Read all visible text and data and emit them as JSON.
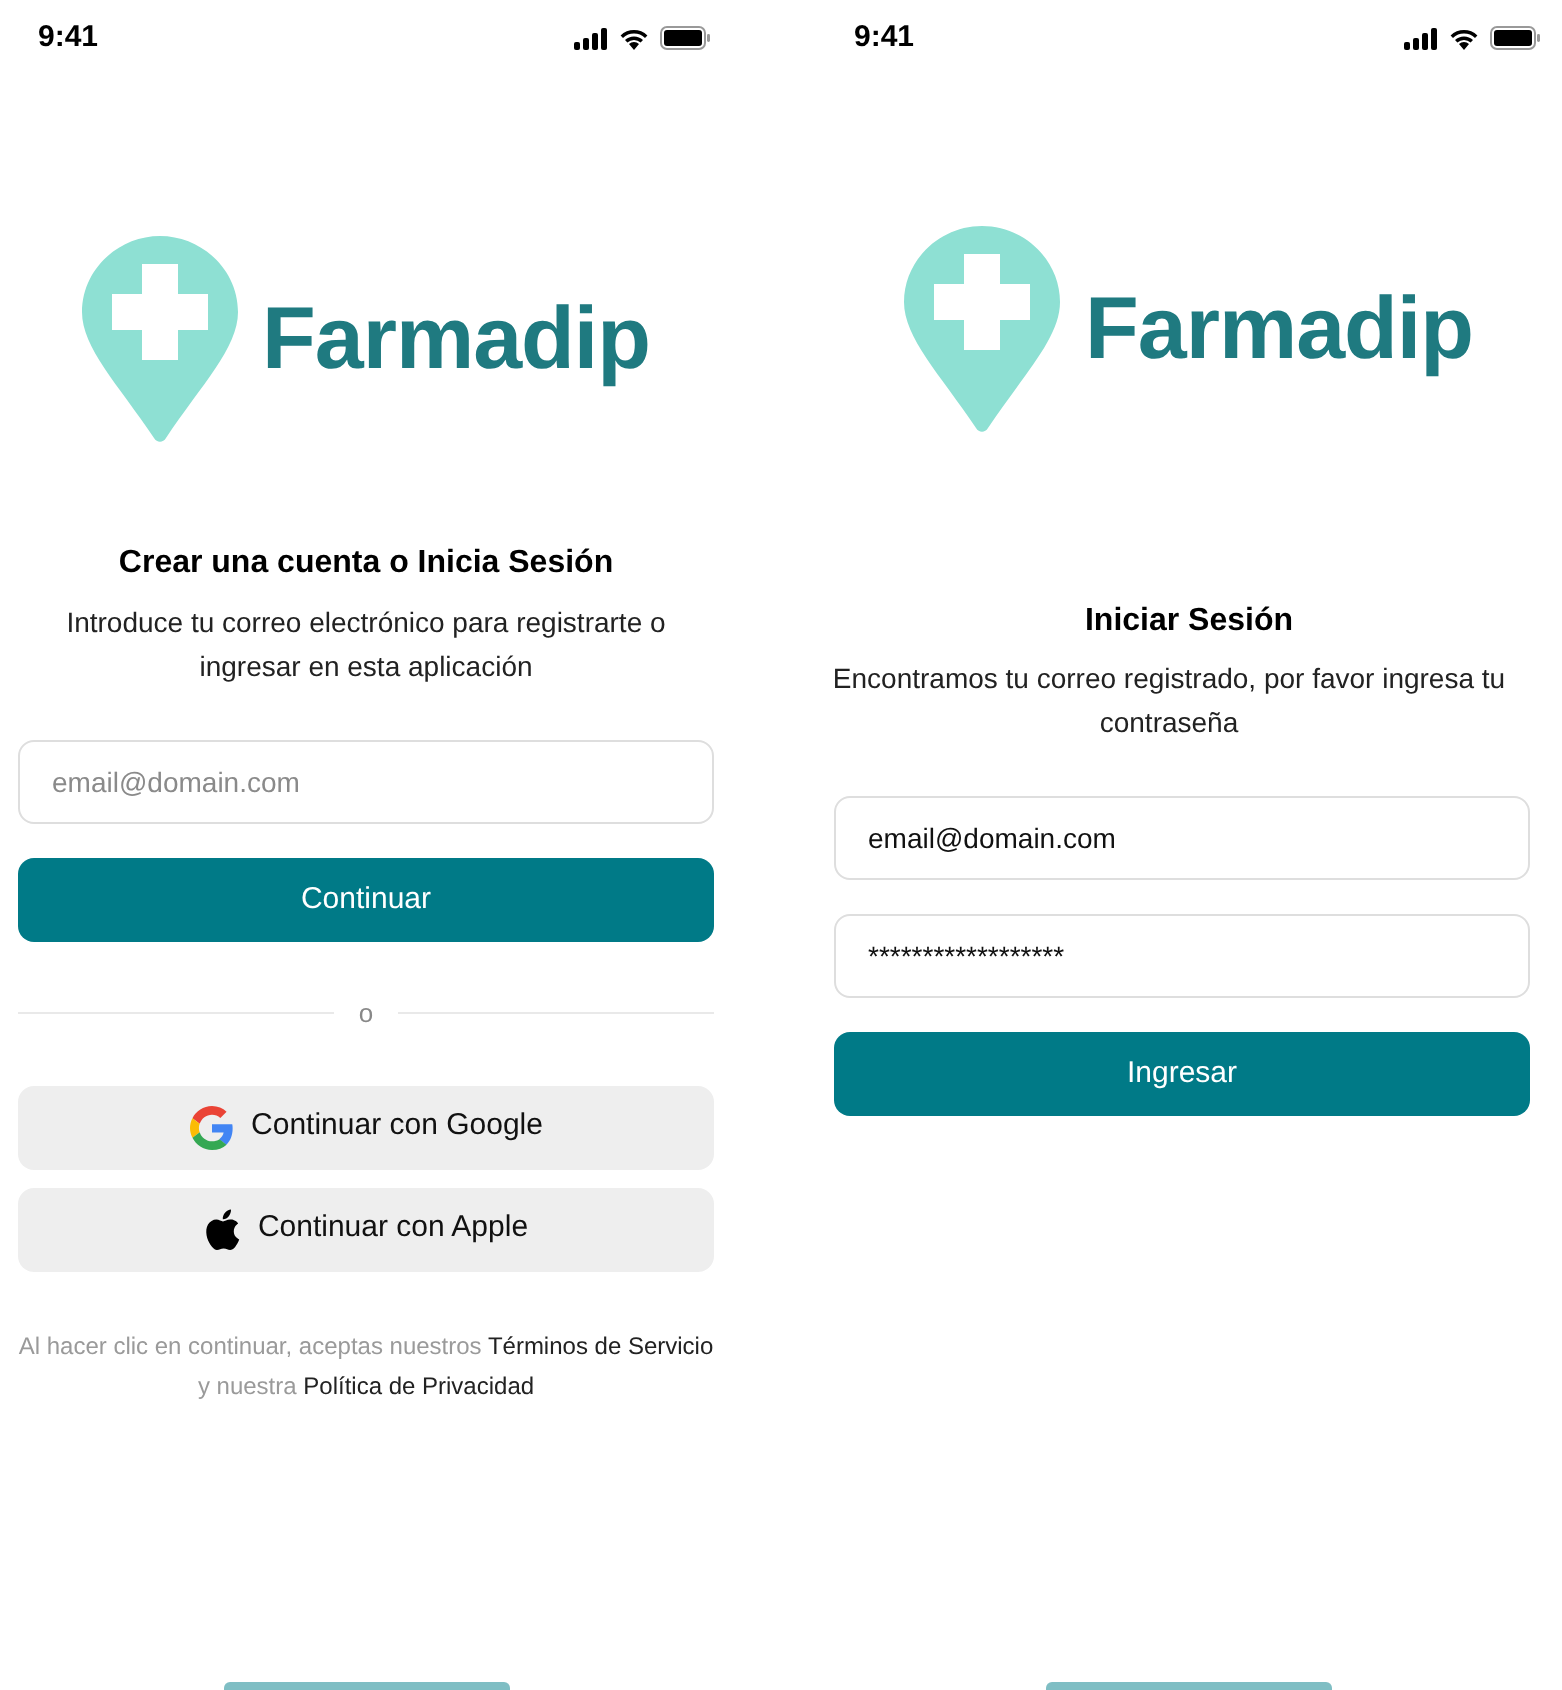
{
  "signup_screen": {
    "status_bar": {
      "time": "9:41"
    },
    "logo": {
      "name": "Farmadip"
    },
    "title": "Crear una cuenta o Inicia Sesión",
    "subtitle": "Introduce tu correo electrónico para registrarte o ingresar en esta aplicación",
    "email_field": {
      "placeholder": "email@domain.com"
    },
    "continue_button": "Continuar",
    "divider_label": "o",
    "social_buttons": [
      {
        "kind": "google",
        "label": "Continuar con Google"
      },
      {
        "kind": "apple",
        "label": "Continuar con Apple"
      }
    ],
    "terms": [
      {
        "kind": "plain",
        "text": "Al hacer clic en continuar, aceptas nuestros"
      },
      {
        "kind": "link",
        "text": "Términos de Servicio"
      },
      {
        "kind": "plain",
        "text": "y nuestra"
      },
      {
        "kind": "link",
        "text": "Política de Privacidad"
      }
    ]
  },
  "login_screen": {
    "status_bar": {
      "time": "9:41"
    },
    "logo": {
      "name": "Farmadip"
    },
    "title": "Iniciar Sesión",
    "subtitle": "Encontramos tu correo registrado, por favor ingresa tu contraseña",
    "email_field": {
      "value": "email@domain.com"
    },
    "password_field": {
      "value": "******************"
    },
    "login_button": "Ingresar"
  }
}
